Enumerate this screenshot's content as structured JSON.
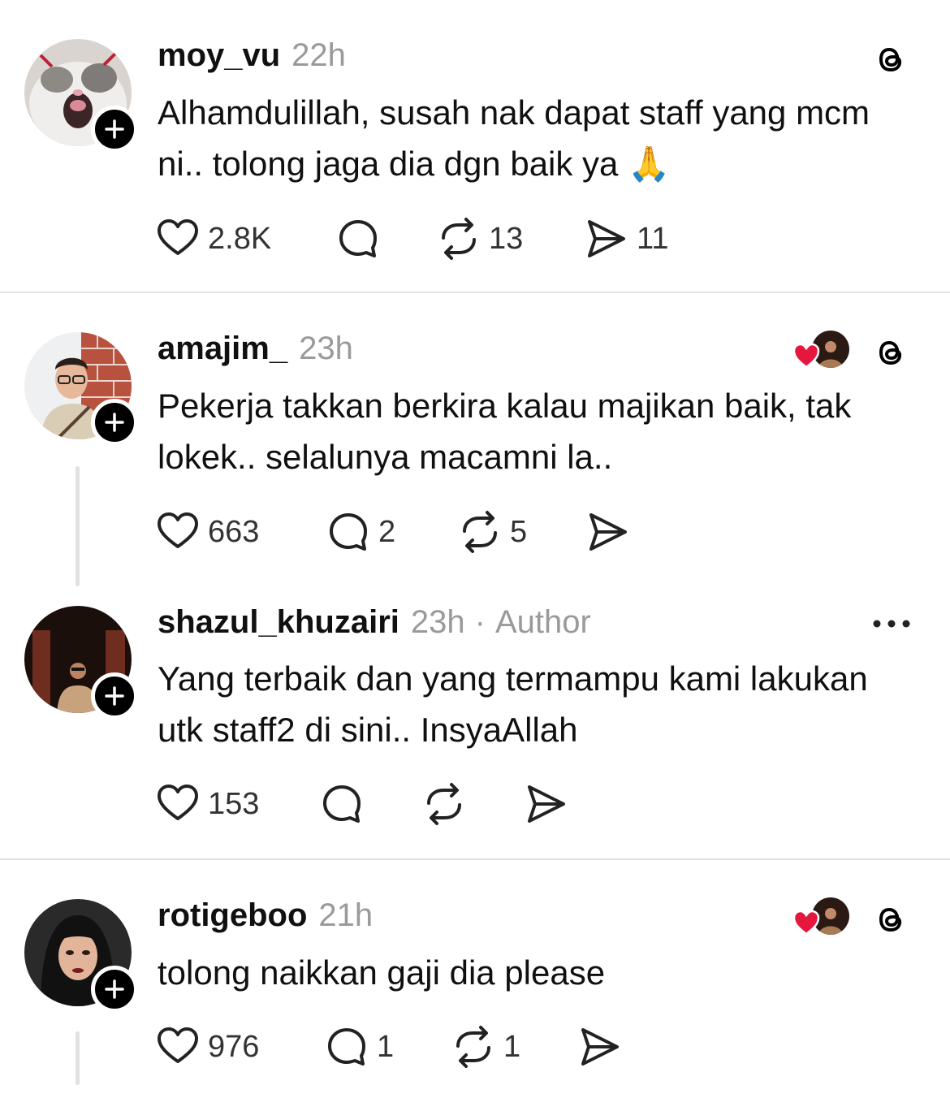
{
  "colors": {
    "text": "#101010",
    "muted": "#9a9a9a",
    "divider": "#e3e3e3",
    "like_red": "#e5173f"
  },
  "posts": [
    {
      "username": "moy_vu",
      "time": "22h",
      "text": "Alhamdulillah, susah nak dapat staff yang mcm ni.. tolong jaga dia dgn baik ya 🙏",
      "likes": "2.8K",
      "replies": "",
      "reposts": "13",
      "shares": "11"
    },
    {
      "username": "amajim_",
      "time": "23h",
      "text": "Pekerja takkan berkira kalau majikan baik, tak lokek.. selalunya macamni la..",
      "likes": "663",
      "replies": "2",
      "reposts": "5",
      "shares": ""
    },
    {
      "username": "shazul_khuzairi",
      "time": "23h",
      "separator": "·",
      "badge": "Author",
      "text": "Yang terbaik dan yang termampu kami lakukan utk staff2 di sini.. InsyaAllah",
      "likes": "153",
      "replies": "",
      "reposts": "",
      "shares": ""
    },
    {
      "username": "rotigeboo",
      "time": "21h",
      "text": "tolong naikkan gaji dia please",
      "likes": "976",
      "replies": "1",
      "reposts": "1",
      "shares": ""
    }
  ],
  "icons": {
    "like": "heart-icon",
    "reply": "comment-icon",
    "repost": "repost-icon",
    "share": "send-icon",
    "threads": "threads-logo-icon",
    "more": "more-icon",
    "follow": "plus-icon"
  }
}
